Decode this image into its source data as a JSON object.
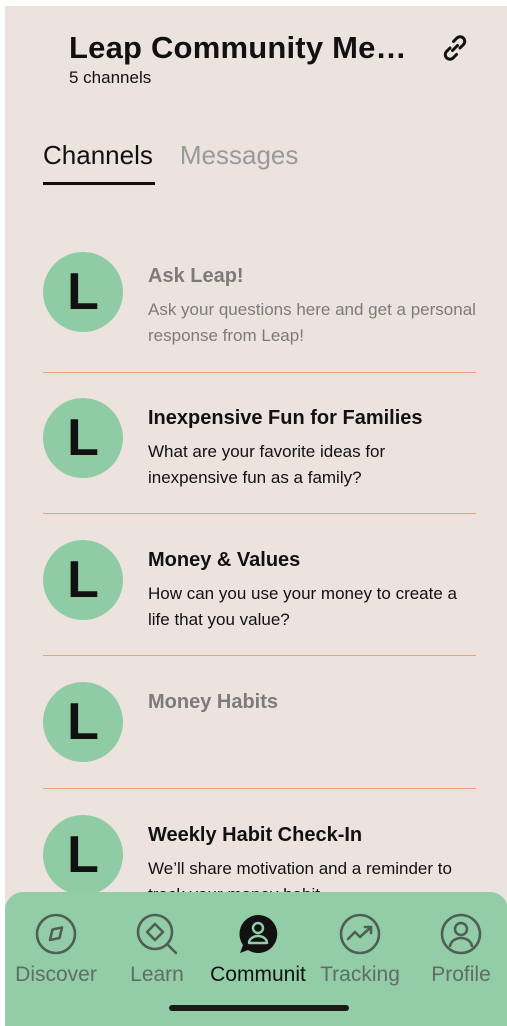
{
  "header": {
    "title": "Leap Community Mess...",
    "subtitle": "5 channels",
    "link_icon": "link-icon"
  },
  "tabs": [
    {
      "label": "Channels",
      "active": true
    },
    {
      "label": "Messages",
      "active": false
    }
  ],
  "channels": [
    {
      "avatar": "L",
      "name": "Ask Leap!",
      "description": "Ask your questions here and get a personal response from Leap!",
      "muted": true
    },
    {
      "avatar": "L",
      "name": "Inexpensive Fun for Families",
      "description": "What are your favorite ideas for inexpensive fun as a family?",
      "muted": false
    },
    {
      "avatar": "L",
      "name": "Money & Values",
      "description": "How can you use your money to create a life that you value?",
      "muted": false
    },
    {
      "avatar": "L",
      "name": "Money Habits",
      "description": "",
      "muted": true
    },
    {
      "avatar": "L",
      "name": "Weekly Habit Check-In",
      "description": "We’ll share motivation and a reminder to track your money habit.",
      "muted": false
    }
  ],
  "bottom_nav": [
    {
      "label": "Discover",
      "icon": "compass-icon",
      "active": false
    },
    {
      "label": "Learn",
      "icon": "search-icon",
      "active": false
    },
    {
      "label": "Communit",
      "icon": "chat-person-icon",
      "active": true
    },
    {
      "label": "Tracking",
      "icon": "trend-icon",
      "active": false
    },
    {
      "label": "Profile",
      "icon": "profile-icon",
      "active": false
    }
  ],
  "colors": {
    "background": "#ece3de",
    "accent_green": "#8fcca6",
    "divider": "#e9a07c"
  }
}
